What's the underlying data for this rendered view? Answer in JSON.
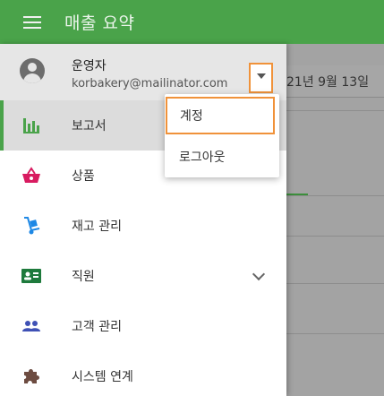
{
  "appbar": {
    "title": "매출 요약"
  },
  "page": {
    "date_text": "21년 9월 13일"
  },
  "profile": {
    "name": "운영자",
    "email": "korbakery@mailinator.com"
  },
  "account_menu": {
    "items": [
      {
        "label": "계정"
      },
      {
        "label": "로그아웃"
      }
    ]
  },
  "sidebar": {
    "items": [
      {
        "label": "보고서",
        "icon": "bar-chart-icon",
        "active": true
      },
      {
        "label": "상품",
        "icon": "basket-icon"
      },
      {
        "label": "재고 관리",
        "icon": "hand-truck-icon"
      },
      {
        "label": "직원",
        "icon": "id-card-icon",
        "expandable": true
      },
      {
        "label": "고객 관리",
        "icon": "people-icon"
      },
      {
        "label": "시스템 연계",
        "icon": "puzzle-icon"
      }
    ]
  },
  "colors": {
    "accent": "#4aa34a",
    "highlight": "#f0923a"
  }
}
